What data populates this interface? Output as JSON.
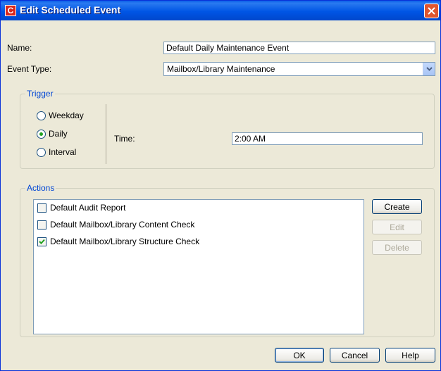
{
  "window": {
    "title": "Edit Scheduled Event",
    "app_icon_letter": "C"
  },
  "form": {
    "name_label": "Name:",
    "name_value": "Default Daily Maintenance Event",
    "event_type_label": "Event Type:",
    "event_type_value": "Mailbox/Library Maintenance"
  },
  "trigger": {
    "title": "Trigger",
    "options": [
      {
        "label": "Weekday",
        "checked": false
      },
      {
        "label": "Daily",
        "checked": true
      },
      {
        "label": "Interval",
        "checked": false
      }
    ],
    "time_label": "Time:",
    "time_value": "2:00 AM"
  },
  "actions": {
    "title": "Actions",
    "items": [
      {
        "label": "Default Audit Report",
        "checked": false
      },
      {
        "label": "Default Mailbox/Library Content Check",
        "checked": false
      },
      {
        "label": "Default Mailbox/Library Structure Check",
        "checked": true
      }
    ],
    "buttons": {
      "create": "Create",
      "edit": "Edit",
      "delete": "Delete"
    }
  },
  "footer": {
    "ok": "OK",
    "cancel": "Cancel",
    "help": "Help"
  },
  "colors": {
    "titlebar": "#0055E5",
    "group_title": "#0046D5",
    "dialog_bg": "#ECE9D8"
  }
}
